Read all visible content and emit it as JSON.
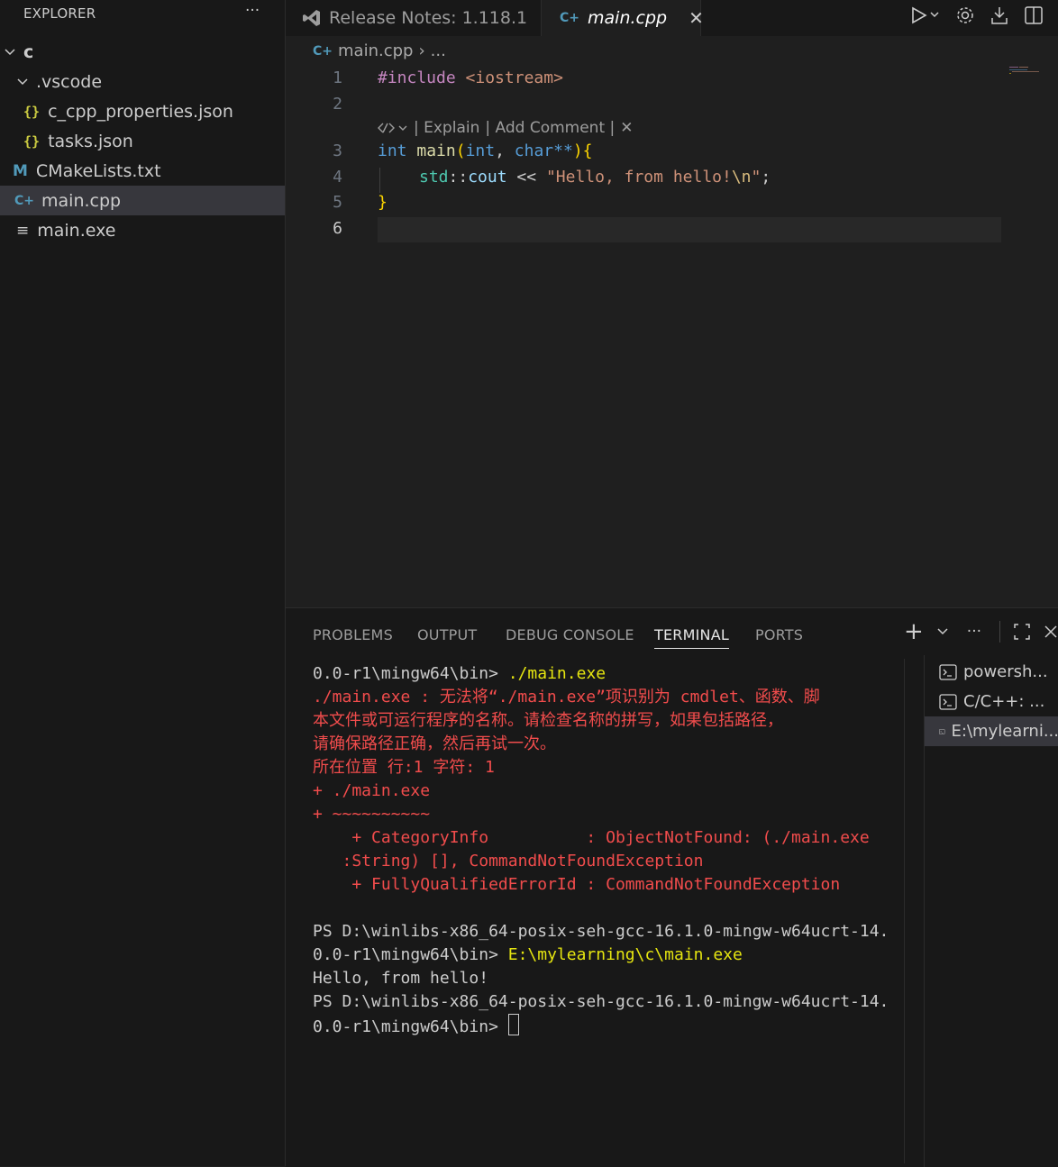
{
  "sidebar": {
    "title": "EXPLORER",
    "more": "···",
    "tree": [
      {
        "label": "c",
        "kind": "folder-open"
      },
      {
        "label": ".vscode",
        "kind": "folder-open"
      },
      {
        "label": "c_cpp_properties.json",
        "kind": "json-file",
        "icon": "{}"
      },
      {
        "label": "tasks.json",
        "kind": "json-file",
        "icon": "{}"
      },
      {
        "label": "CMakeLists.txt",
        "kind": "cmake-file",
        "icon": "M"
      },
      {
        "label": "main.cpp",
        "kind": "cpp-file",
        "icon": "C+",
        "selected": true
      },
      {
        "label": "main.exe",
        "kind": "binary-file",
        "icon": "≡"
      }
    ]
  },
  "tabs": [
    {
      "label": "Release Notes: 1.118.1",
      "icon": "vscode-icon"
    },
    {
      "label": "main.cpp",
      "icon": "cpp-icon",
      "active": true,
      "close": "✕"
    }
  ],
  "breadcrumb": {
    "file": "main.cpp",
    "sep": "›",
    "rest": "..."
  },
  "editor": {
    "line_numbers": [
      "1",
      "2",
      "3",
      "4",
      "5",
      "6"
    ],
    "active_line": "6",
    "codelens": {
      "explain": "| Explain",
      "add_comment": "| Add Comment |",
      "close": "✕"
    },
    "code": {
      "l1_directive": "#include",
      "l1_header": "<iostream>",
      "l3_type": "int",
      "l3_fn": "main",
      "l3_paren_open": "(",
      "l3_type2": "int",
      "l3_comma": ", ",
      "l3_type3": "char",
      "l3_stars": "**",
      "l3_paren_close": ")",
      "l3_brace": "{",
      "l4_ns": "std",
      "l4_scope": "::",
      "l4_cout": "cout",
      "l4_op": "<<",
      "l4_str": "\"Hello, from hello!",
      "l4_esc": "\\n",
      "l4_strend": "\"",
      "l4_semi": ";",
      "l5_brace": "}"
    }
  },
  "panel": {
    "tabs": [
      "PROBLEMS",
      "OUTPUT",
      "DEBUG CONSOLE",
      "TERMINAL",
      "PORTS"
    ],
    "active_tab": "TERMINAL",
    "plus": "+",
    "more": "···"
  },
  "terminal": {
    "prompt1": "0.0-r1\\mingw64\\bin> ",
    "cmd1": "./main.exe",
    "err_lines": [
      "./main.exe : 无法将“./main.exe”项识别为 cmdlet、函数、脚",
      "本文件或可运行程序的名称。请检查名称的拼写，如果包括路径，",
      "请确保路径正确，然后再试一次。",
      "所在位置 行:1 字符: 1",
      "+ ./main.exe",
      "+ ~~~~~~~~~~",
      "    + CategoryInfo          : ObjectNotFound: (./main.exe",
      "   :String) [], CommandNotFoundException",
      "    + FullyQualifiedErrorId : CommandNotFoundException"
    ],
    "ps_line_a": "PS D:\\winlibs-x86_64-posix-seh-gcc-16.1.0-mingw-w64ucrt-14.",
    "prompt2": "0.0-r1\\mingw64\\bin> ",
    "cmd2": "E:\\mylearning\\c\\main.exe",
    "output": "Hello, from hello!",
    "ps_line_b": "PS D:\\winlibs-x86_64-posix-seh-gcc-16.1.0-mingw-w64ucrt-14.",
    "prompt3": "0.0-r1\\mingw64\\bin> "
  },
  "terminal_list": [
    {
      "label": "powersh..."
    },
    {
      "label": "C/C++: ..."
    },
    {
      "label": "E:\\mylearni...",
      "selected": true
    }
  ],
  "colors": {
    "keyword": "#569cd6",
    "directive": "#c586c0",
    "function": "#dcdcaa",
    "string": "#ce9178",
    "escape": "#d7ba7d",
    "type": "#4ec9b0",
    "error_text": "#f14c4c",
    "command_text": "#e5e510"
  }
}
